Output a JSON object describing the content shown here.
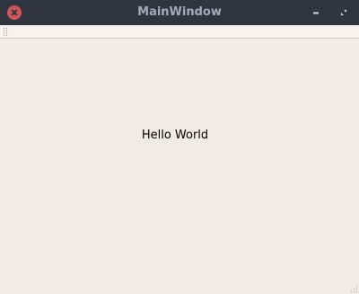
{
  "window": {
    "title": "MainWindow"
  },
  "titlebar_buttons": {
    "close": "close-icon",
    "minimize": "minimize-icon",
    "maximize": "maximize-icon"
  },
  "central": {
    "label_text": "Hello World"
  },
  "colors": {
    "titlebar_bg": "#2f343f",
    "title_text": "#a5abb8",
    "close_button": "#cc575d",
    "window_bg": "#efebe7"
  }
}
